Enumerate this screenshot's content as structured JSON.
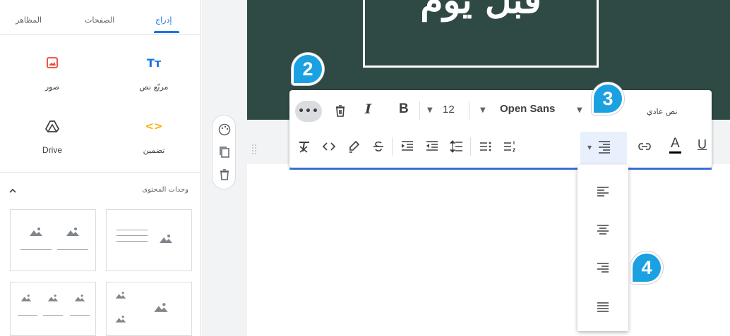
{
  "sidebar": {
    "tabs": [
      {
        "label": "إدراج",
        "active": true
      },
      {
        "label": "الصفحات",
        "active": false
      },
      {
        "label": "المظاهر",
        "active": false
      }
    ],
    "insert_items": [
      {
        "label": "مربّع نص",
        "icon": "text-box-icon",
        "glyph": "Tт"
      },
      {
        "label": "صور",
        "icon": "image-icon"
      },
      {
        "label": "تضمين",
        "icon": "embed-icon",
        "glyph": "<>"
      },
      {
        "label": "Drive",
        "icon": "drive-icon"
      }
    ],
    "content_blocks_title": "وحدات المحتوى"
  },
  "banner": {
    "title": "قبل يوم"
  },
  "toolbar": {
    "more_label": "•••",
    "font_size": "12",
    "font_name": "Open Sans",
    "text_style": "نص عادي",
    "bold_label": "B",
    "italic_label": "I",
    "underline_label": "U",
    "text_color_label": "A"
  },
  "align_menu": {
    "options": [
      "align-left",
      "align-center",
      "align-right",
      "justify"
    ]
  },
  "steps": [
    "2",
    "3",
    "4"
  ],
  "colors": {
    "accent": "#1a73e8",
    "banner": "#2f4a44",
    "badge": "#1ba1e2"
  }
}
